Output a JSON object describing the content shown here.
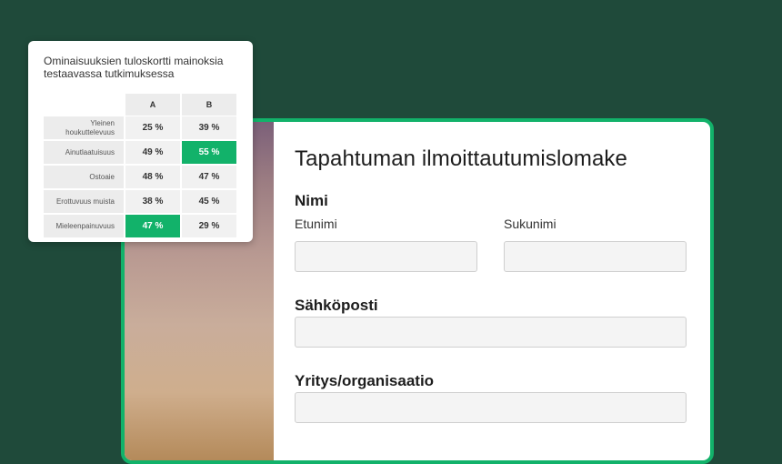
{
  "colors": {
    "background": "#1f4a3a",
    "accent": "#12b26a"
  },
  "form": {
    "title": "Tapahtuman ilmoittautumislomake",
    "name_section": "Nimi",
    "first_name_label": "Etunimi",
    "last_name_label": "Sukunimi",
    "email_label": "Sähköposti",
    "company_label": "Yritys/organisaatio"
  },
  "scorecard": {
    "title": "Ominaisuuksien tuloskortti mainoksia testaavassa tutkimuksessa",
    "columns": [
      "A",
      "B"
    ],
    "rows": [
      {
        "label": "Yleinen houkuttelevuus",
        "a": "25 %",
        "b": "39 %",
        "highlight": ""
      },
      {
        "label": "Ainutlaatuisuus",
        "a": "49 %",
        "b": "55 %",
        "highlight": "b"
      },
      {
        "label": "Ostoaie",
        "a": "48 %",
        "b": "47 %",
        "highlight": ""
      },
      {
        "label": "Erottuvuus muista",
        "a": "38 %",
        "b": "45 %",
        "highlight": ""
      },
      {
        "label": "Mieleenpainuvuus",
        "a": "47 %",
        "b": "29 %",
        "highlight": "a"
      }
    ]
  }
}
